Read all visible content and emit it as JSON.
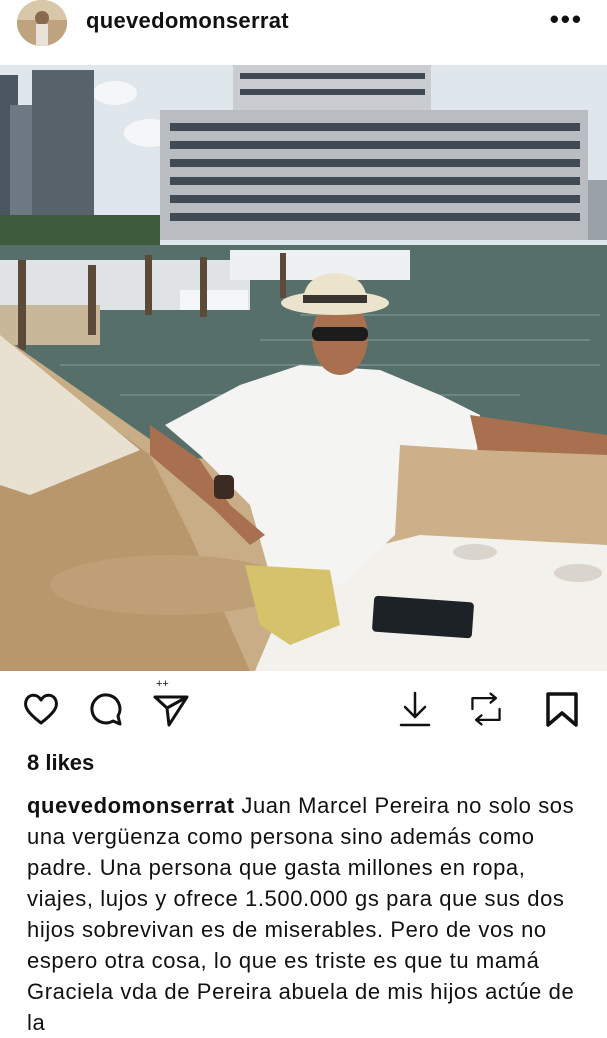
{
  "post": {
    "username": "quevedomonserrat",
    "more_icon": "more-horizontal-icon",
    "more_glyph": "•••",
    "likes": "8 likes",
    "caption_user": "quevedomonserrat",
    "caption_text": " Juan Marcel Pereira no solo sos una vergüenza como persona sino además como padre. Una persona que gasta millones en ropa, viajes, lujos y ofrece 1.500.000 gs para que sus dos hijos sobrevivan es de miserables. Pero de vos no espero otra cosa, lo que es triste es que tu mamá Graciela vda de Pereira abuela de mis hijos actúe de la"
  },
  "actions": {
    "icons": [
      "heart-icon",
      "comment-icon",
      "share-icon",
      "download-icon",
      "repost-icon",
      "bookmark-icon"
    ]
  },
  "colors": {
    "water": "#566f6a",
    "sky": "#dfe6ec",
    "seat": "#c8ad86"
  }
}
